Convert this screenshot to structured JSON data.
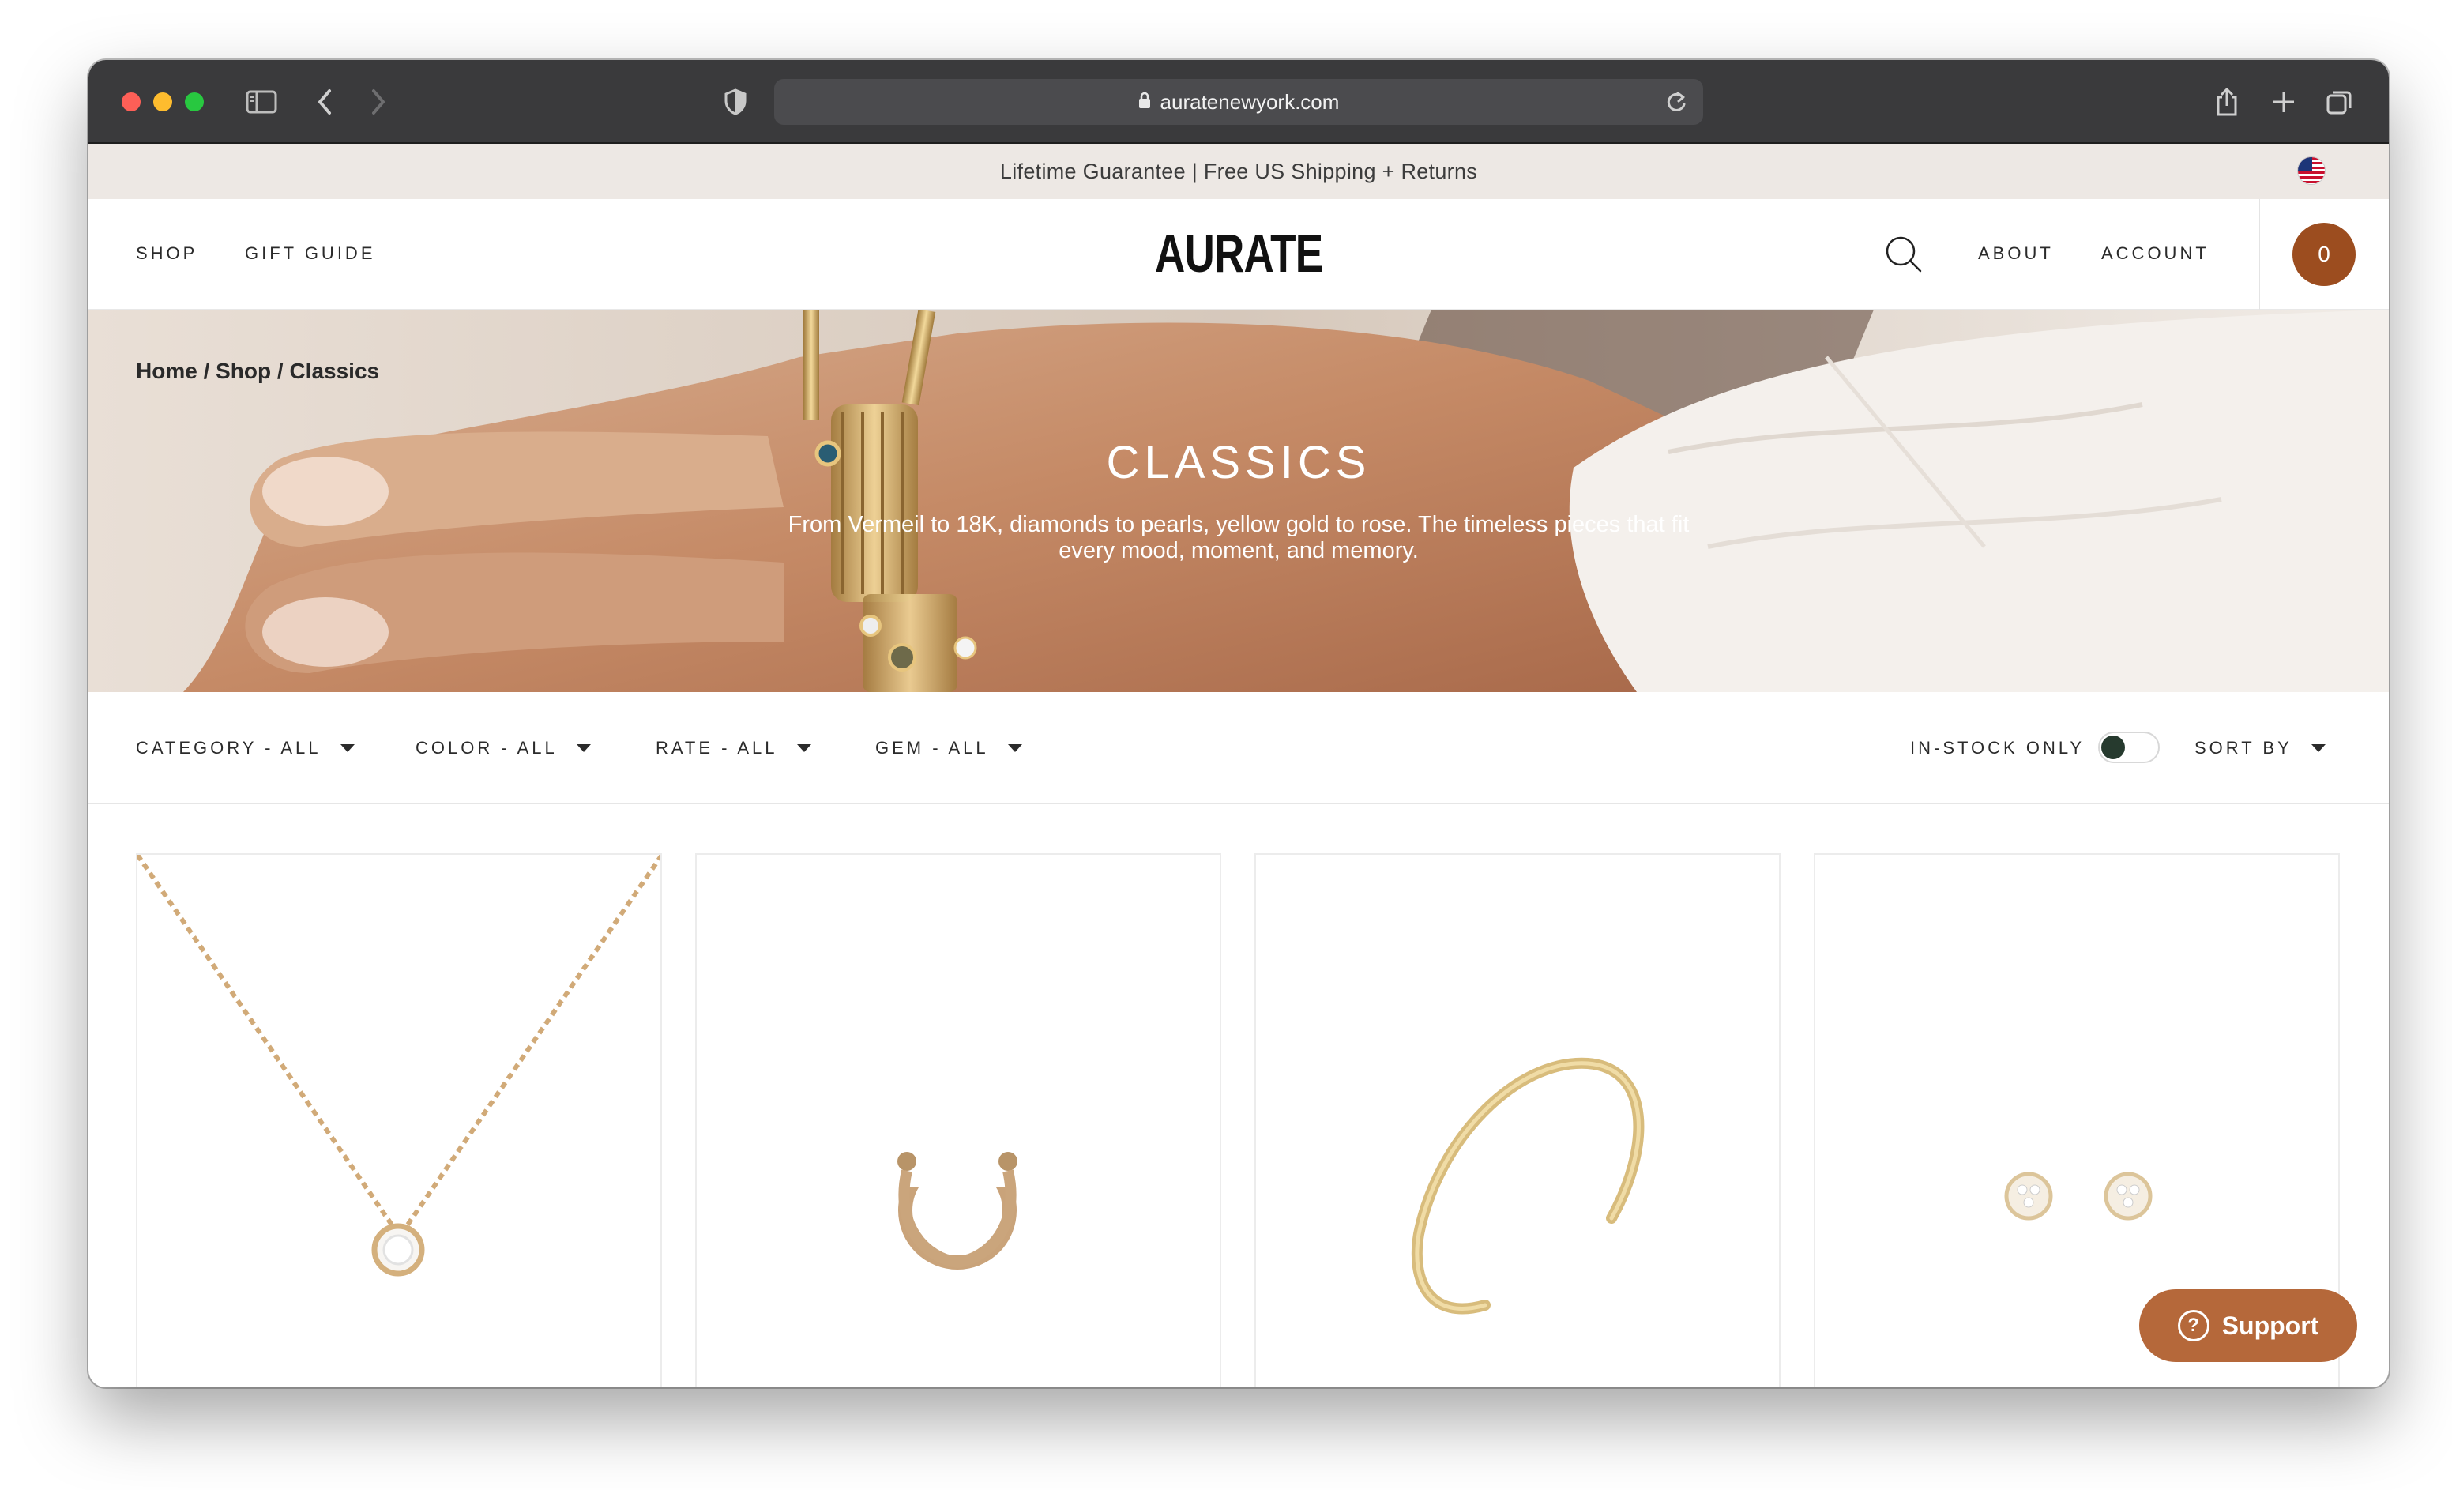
{
  "browser": {
    "url": "auratenewyork.com"
  },
  "announcement": {
    "text": "Lifetime Guarantee | Free US Shipping + Returns"
  },
  "header": {
    "nav_left": [
      "SHOP",
      "GIFT GUIDE"
    ],
    "logo": "AURATE",
    "nav_right": [
      "ABOUT",
      "ACCOUNT"
    ],
    "cart_count": "0"
  },
  "hero": {
    "breadcrumb": "Home / Shop / Classics",
    "title": "CLASSICS",
    "subtitle_line1": "From Vermeil to 18K, diamonds to pearls, yellow gold to rose. The timeless pieces that fit",
    "subtitle_line2": "every mood, moment, and memory."
  },
  "filters": {
    "items": [
      "CATEGORY - ALL",
      "COLOR - ALL",
      "RATE - ALL",
      "GEM - ALL"
    ],
    "in_stock_label": "IN-STOCK ONLY",
    "in_stock_on": false,
    "sort_label": "SORT BY"
  },
  "products": [
    {
      "type": "necklace-icon"
    },
    {
      "type": "ring-icon"
    },
    {
      "type": "bracelet-icon"
    },
    {
      "type": "earrings-icon"
    }
  ],
  "support": {
    "label": "Support"
  },
  "colors": {
    "brand_brown": "#9c4d1f",
    "support_orange": "#b5683a",
    "announcement_bg": "#ede8e4"
  }
}
